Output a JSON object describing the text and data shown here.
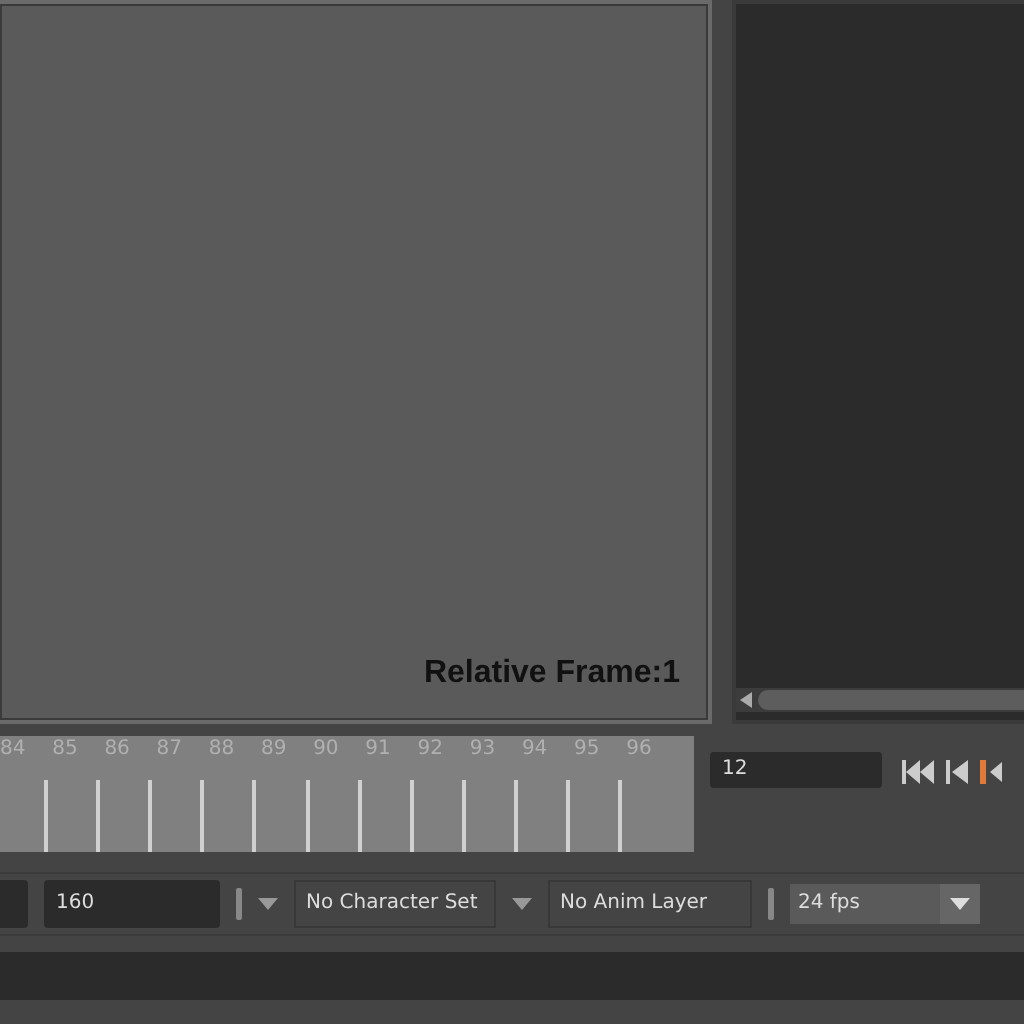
{
  "viewport": {
    "overlay_text": "Relative Frame:1"
  },
  "timeline": {
    "frames": [
      "84",
      "85",
      "86",
      "87",
      "88",
      "89",
      "90",
      "91",
      "92",
      "93",
      "94",
      "95",
      "96"
    ]
  },
  "current_frame": "12",
  "range": {
    "end": "160"
  },
  "character_set": "No Character Set",
  "anim_layer": "No Anim Layer",
  "fps": "24 fps"
}
